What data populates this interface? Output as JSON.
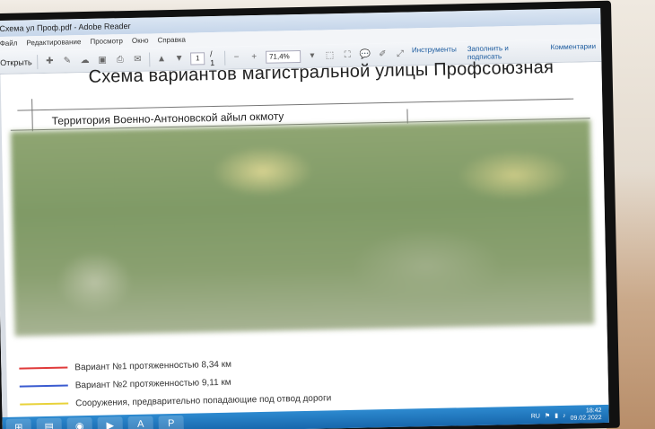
{
  "window": {
    "title": "Схема ул Проф.pdf - Adobe Reader"
  },
  "menu": [
    "Файл",
    "Редактирование",
    "Просмотр",
    "Окно",
    "Справка"
  ],
  "toolbar": {
    "open_label": "Открыть",
    "page_current": "1",
    "page_total": "/ 1",
    "zoom": "71,4%",
    "tools_label": "Инструменты",
    "fill_sign_label": "Заполнить и подписать",
    "comments_label": "Комментарии"
  },
  "document": {
    "title": "Схема вариантов магистральной улицы Профсоюзная",
    "subtitle": "Территория Военно-Антоновской айыл окмоту",
    "legend": [
      {
        "label": "Вариант №1 протяженностью 8,34 км",
        "color": "#e03a3a"
      },
      {
        "label": "Вариант №2 протяженностью 9,11 км",
        "color": "#3a5bd0"
      },
      {
        "label": "Сооружения, предварительно попадающие под отвод дороги",
        "color": "#e8d23a"
      }
    ]
  },
  "taskbar": {
    "lang": "RU",
    "time": "18:42",
    "date": "09.02.2022",
    "apps": [
      "start-icon",
      "explorer-icon",
      "chrome-icon",
      "media-player-icon",
      "acrobat-icon",
      "powerpoint-icon"
    ]
  }
}
